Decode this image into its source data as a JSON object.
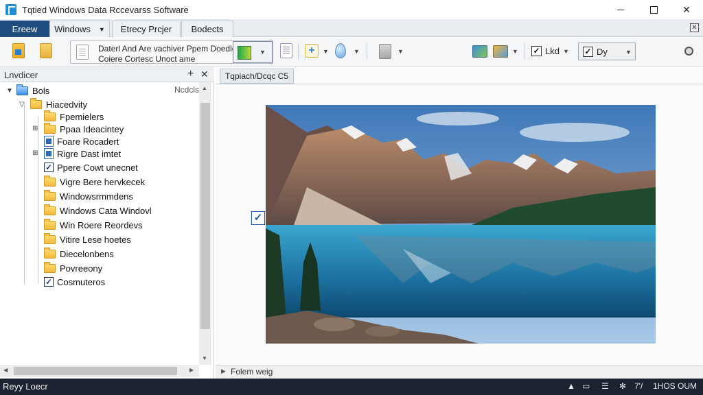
{
  "window": {
    "title": "Tqtied Windows Data Rccevarss Software",
    "close_label": "✕"
  },
  "tabs": [
    {
      "label": "Ereew",
      "active": true
    },
    {
      "label": "Windows",
      "caret": "▼"
    },
    {
      "label": "Etrecy Prcjer"
    },
    {
      "label": "Bodects"
    }
  ],
  "ribbon_close": "✕",
  "toolbar": {
    "combo_line1": "Daterl And Are vachiver Ppem Doedle",
    "combo_line2": "Coiere Cortesc Unoct ame",
    "check1_label": "Lkd",
    "check2_label": "Dy",
    "check_mark": "✓",
    "caret": "▼"
  },
  "left_panel": {
    "title": "Lnvdicer",
    "pin": "+",
    "close": "✕",
    "extra_label": "Ncdcls",
    "tree": [
      {
        "label": "Bols",
        "kind": "root"
      },
      {
        "label": "Hiacedvity",
        "kind": "folder"
      },
      {
        "label": "Fpemielers",
        "kind": "folder"
      },
      {
        "label": "Ppaa Ideacintey",
        "kind": "folder"
      },
      {
        "label": "Foare Rocadert",
        "kind": "doc"
      },
      {
        "label": "Rigre Dast imtet",
        "kind": "doc"
      },
      {
        "label": "Ppere Cowt unecnet",
        "kind": "check"
      },
      {
        "label": "Vigre Bere hervkecek",
        "kind": "folder"
      },
      {
        "label": "Windowsrmmdens",
        "kind": "folder"
      },
      {
        "label": "Windows Cata Windovl",
        "kind": "folder"
      },
      {
        "label": "Win Roere Reordevs",
        "kind": "folder"
      },
      {
        "label": "Vitire Lese hoetes",
        "kind": "folder"
      },
      {
        "label": "Diecelonbens",
        "kind": "folder"
      },
      {
        "label": "Povreeony",
        "kind": "folder"
      },
      {
        "label": "Cosmuteros",
        "kind": "check"
      }
    ]
  },
  "main": {
    "doc_tab": "Tqpiach/Dcqc C5",
    "photo_alt": "Mountain lake landscape",
    "bottom_label": "Folem weig",
    "bottom_caret": "▶"
  },
  "taskbar": {
    "left_text": "Reyy Loecr",
    "tray_caret": "▲",
    "clock": "1HOS OUM",
    "tray_temp": "7'/"
  },
  "colors": {
    "accent": "#1f4d80",
    "taskbar": "#1c2330",
    "folder": "#f2b93a"
  }
}
